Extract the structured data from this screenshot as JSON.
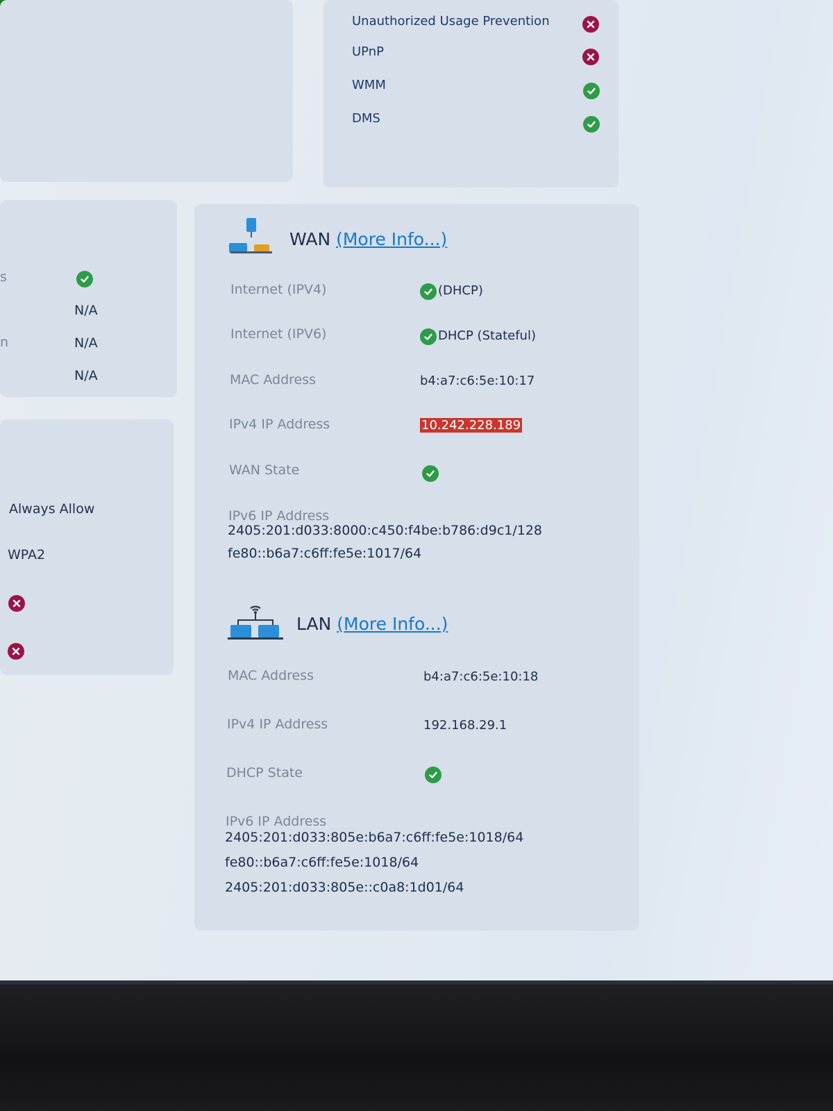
{
  "top_features": {
    "items": [
      {
        "label": "Unauthorized Usage Prevention",
        "status": "disabled"
      },
      {
        "label": "UPnP",
        "status": "disabled"
      },
      {
        "label": "WMM",
        "status": "enabled"
      },
      {
        "label": "DMS",
        "status": "enabled"
      }
    ]
  },
  "left_panel_1": {
    "row1_label_fragment": "s",
    "row1_status": "enabled",
    "row2_value": "N/A",
    "row3_label_fragment": "n",
    "row3_value": "N/A",
    "row4_value": "N/A"
  },
  "left_panel_2": {
    "row1_value": "Always Allow",
    "row2_value": "WPA2",
    "row3_status": "disabled",
    "row4_status": "disabled"
  },
  "wan": {
    "title": "WAN",
    "more_info": "(More Info...)",
    "internet_ipv4_label": "Internet (IPV4)",
    "internet_ipv4_value": "(DHCP)",
    "internet_ipv6_label": "Internet (IPV6)",
    "internet_ipv6_value": "DHCP (Stateful)",
    "mac_label": "MAC Address",
    "mac_value": "b4:a7:c6:5e:10:17",
    "ipv4_label": "IPv4 IP Address",
    "ipv4_value": "10.242.228.189",
    "state_label": "WAN State",
    "ipv6_label": "IPv6 IP Address",
    "ipv6_values": [
      "2405:201:d033:8000:c450:f4be:b786:d9c1/128",
      "fe80::b6a7:c6ff:fe5e:1017/64"
    ]
  },
  "lan": {
    "title": "LAN",
    "more_info": "(More Info...)",
    "mac_label": "MAC Address",
    "mac_value": "b4:a7:c6:5e:10:18",
    "ipv4_label": "IPv4 IP Address",
    "ipv4_value": "192.168.29.1",
    "dhcp_label": "DHCP State",
    "ipv6_label": "IPv6 IP Address",
    "ipv6_values": [
      "2405:201:d033:805e:b6a7:c6ff:fe5e:1018/64",
      "fe80::b6a7:c6ff:fe5e:1018/64",
      "2405:201:d033:805e::c0a8:1d01/64"
    ]
  },
  "colors": {
    "enabled": "#2e9b48",
    "disabled": "#9b1349",
    "link": "#1a78c6",
    "highlight": "#c8372e"
  }
}
